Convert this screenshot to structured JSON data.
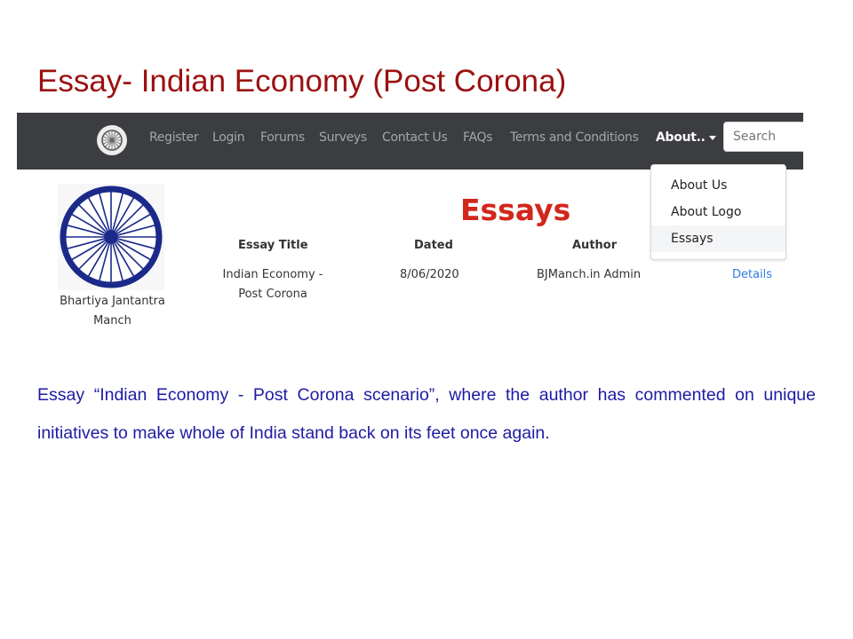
{
  "slide": {
    "title": "Essay- Indian Economy (Post Corona)",
    "body": "Essay “Indian Economy - Post Corona scenario”, where the author has commented on unique initiatives to make whole of India stand back on its feet once again."
  },
  "navbar": {
    "items": [
      "Register",
      "Login",
      "Forums",
      "Surveys",
      "Contact Us",
      "FAQs",
      "Terms and Conditions"
    ],
    "about_label": "About..",
    "search_placeholder": "Search"
  },
  "dropdown": {
    "items": [
      "About Us",
      "About Logo",
      "Essays"
    ],
    "active": "Essays"
  },
  "site": {
    "name_line1": "Bhartiya Jantantra",
    "name_line2": "Manch"
  },
  "essays": {
    "heading": "Essays",
    "columns": [
      "Essay Title",
      "Dated",
      "Author"
    ],
    "row": {
      "title_line1": "Indian Economy -",
      "title_line2": "Post Corona",
      "dated": "8/06/2020",
      "author": "BJManch.in Admin",
      "details": "Details"
    }
  },
  "colors": {
    "title": "#9b1111",
    "body_text": "#1f1ba3",
    "navbar_bg": "#3b3d40",
    "essays_heading": "#d2271b",
    "link": "#2f7de1",
    "chakra": "#1b2a8a"
  },
  "icons": {
    "nav_logo": "ashoka-chakra-icon",
    "emblem": "ashoka-chakra-icon",
    "about_caret": "caret-down-icon"
  }
}
